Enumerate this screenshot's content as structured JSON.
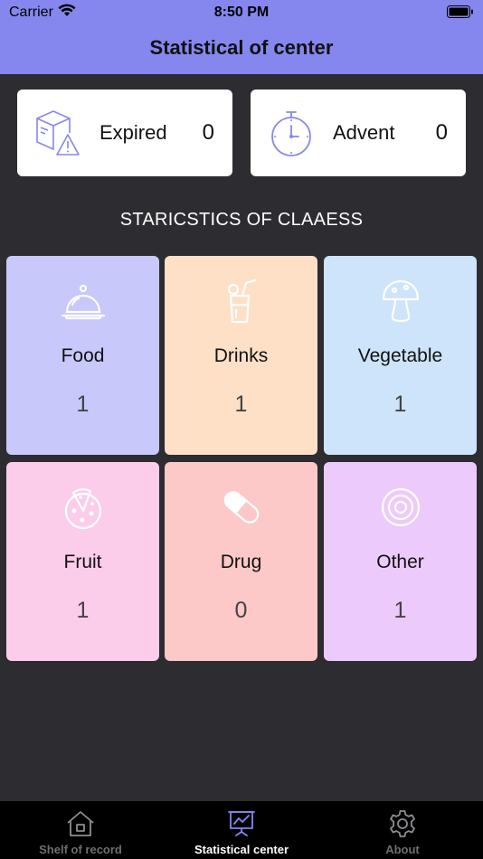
{
  "status_bar": {
    "carrier": "Carrier",
    "time": "8:50 PM"
  },
  "header": {
    "title": "Statistical of center"
  },
  "summary": {
    "expired": {
      "label": "Expired",
      "count": "0"
    },
    "advent": {
      "label": "Advent",
      "count": "0"
    }
  },
  "section_title": "STARICSTICS OF CLAAESS",
  "categories": [
    {
      "name": "Food",
      "count": "1",
      "color": "#c8c8fb",
      "icon": "food-cloche-icon"
    },
    {
      "name": "Drinks",
      "count": "1",
      "color": "#fde0c6",
      "icon": "drink-glass-icon"
    },
    {
      "name": "Vegetable",
      "count": "1",
      "color": "#cde4fb",
      "icon": "mushroom-icon"
    },
    {
      "name": "Fruit",
      "count": "1",
      "color": "#fbcdea",
      "icon": "pizza-fruit-icon"
    },
    {
      "name": "Drug",
      "count": "0",
      "color": "#fcc8c8",
      "icon": "pill-capsule-icon"
    },
    {
      "name": "Other",
      "count": "1",
      "color": "#eccafb",
      "icon": "target-circle-icon"
    }
  ],
  "tabs": [
    {
      "label": "Shelf of record",
      "icon": "house-icon",
      "active": false
    },
    {
      "label": "Statistical center",
      "icon": "chart-board-icon",
      "active": true
    },
    {
      "label": "About",
      "icon": "gear-icon",
      "active": false
    }
  ],
  "colors": {
    "header": "#8587ef",
    "background": "#2c2c31",
    "accent": "#8587ef",
    "tab_inactive": "#6e6e73"
  }
}
